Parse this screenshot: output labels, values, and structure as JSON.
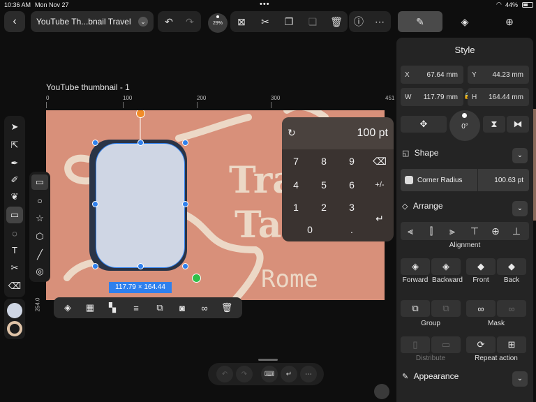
{
  "status": {
    "time": "10:36 AM",
    "date": "Mon Nov 27",
    "battery": "44%"
  },
  "document": {
    "name": "YouTube Th...bnail Travel",
    "zoom": "29%"
  },
  "canvas": {
    "artboard_title": "YouTube thumbnail - 1",
    "ruler_h": [
      "0",
      "100",
      "200",
      "300",
      "451"
    ],
    "ruler_v": [
      "254.0"
    ],
    "art_texts": {
      "line1": "Tra",
      "line2": "Ta",
      "line3": "Rome"
    },
    "selection_size": "117.79 × 164.44"
  },
  "numpad": {
    "value": "100 pt",
    "keys": [
      "7",
      "8",
      "9",
      "4",
      "5",
      "6",
      "1",
      "2",
      "3",
      "0",
      "."
    ],
    "plusminus": "+/-"
  },
  "panel": {
    "tabs": [
      "brush-icon",
      "layers-icon",
      "add-icon"
    ],
    "title": "Style",
    "x_label": "X",
    "x_value": "67.64 mm",
    "y_label": "Y",
    "y_value": "44.23 mm",
    "w_label": "W",
    "w_value": "117.79 mm",
    "h_label": "H",
    "h_value": "164.44 mm",
    "rotation": "0°",
    "shape_section": "Shape",
    "corner_radius_label": "Corner Radius",
    "corner_radius_value": "100.63 pt",
    "arrange_section": "Arrange",
    "alignment_label": "Alignment",
    "forward": "Forward",
    "backward": "Backward",
    "front": "Front",
    "back": "Back",
    "group": "Group",
    "mask": "Mask",
    "distribute": "Distribute",
    "repeat_action": "Repeat action",
    "appearance_section": "Appearance"
  },
  "colors": {
    "accent": "#2f80ed",
    "artboard": "#d8907a",
    "shape_fill": "#cfd6e4",
    "handle_top": "#f28c28",
    "handle_rotate": "#2fbf4a"
  }
}
